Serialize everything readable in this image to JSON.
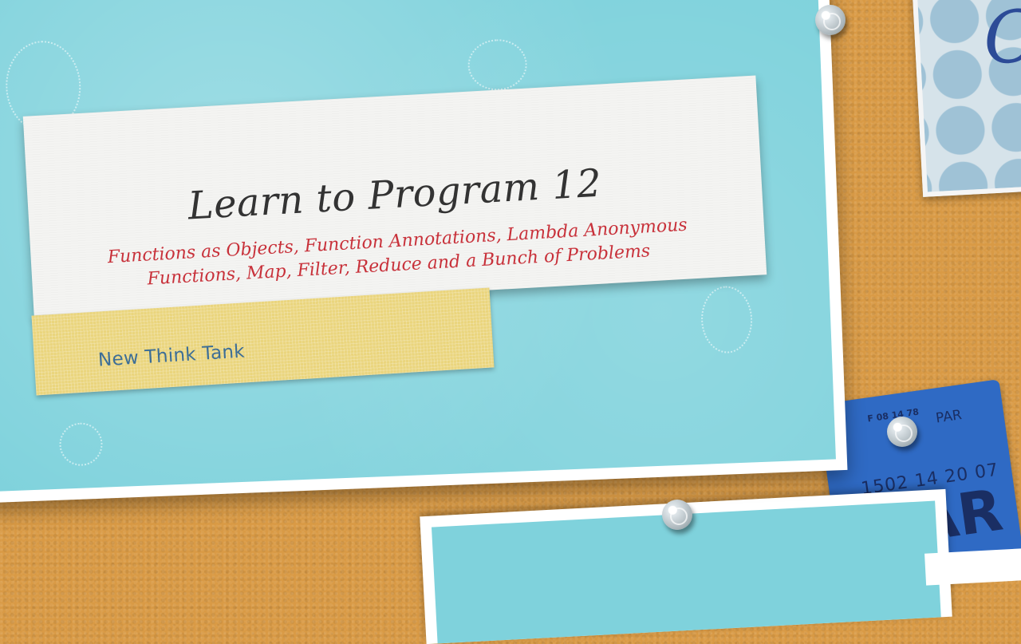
{
  "slide": {
    "title": "Learn to Program 12",
    "subtitle_line1": "Functions as Objects, Function Annotations, Lambda Anonymous",
    "subtitle_line2": "Functions, Map, Filter, Reduce and a Bunch of Problems",
    "brand": "New Think Tank"
  },
  "decor": {
    "polka_letter": "C",
    "tag_small": "F 08 14 78",
    "tag_code": "PAR",
    "tag_number": "1502 14 20 07",
    "tag_big": "AR"
  },
  "colors": {
    "cork": "#d99a45",
    "card_blue": "#7fd2dc",
    "title_text": "#333333",
    "subtitle_red": "#c8313a",
    "tape_yellow": "#ead57d",
    "brand_blue": "#3d6e96",
    "tag_blue": "#2f6ac4"
  }
}
